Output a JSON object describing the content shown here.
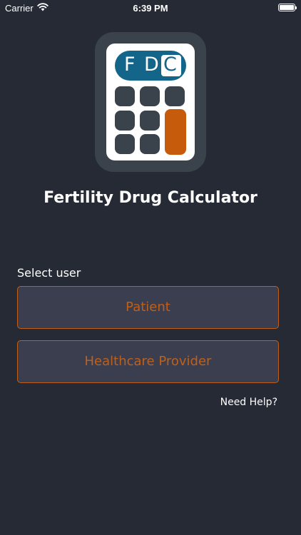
{
  "status_bar": {
    "carrier": "Carrier",
    "time": "6:39 PM",
    "wifi_icon": "wifi-icon",
    "battery_icon": "battery-icon"
  },
  "logo": {
    "letter_1": "F",
    "letter_2": "D",
    "letter_3": "C",
    "display_color": "#136689",
    "accent_key_color": "#c65c0b"
  },
  "app": {
    "title": "Fertility Drug Calculator"
  },
  "user_select": {
    "label": "Select user",
    "options": [
      {
        "label": "Patient"
      },
      {
        "label": "Healthcare Provider"
      }
    ],
    "accent_color": "#c06018"
  },
  "help": {
    "label": "Need Help?"
  },
  "colors": {
    "background": "#252a35",
    "button_background": "#3a3e4f"
  }
}
